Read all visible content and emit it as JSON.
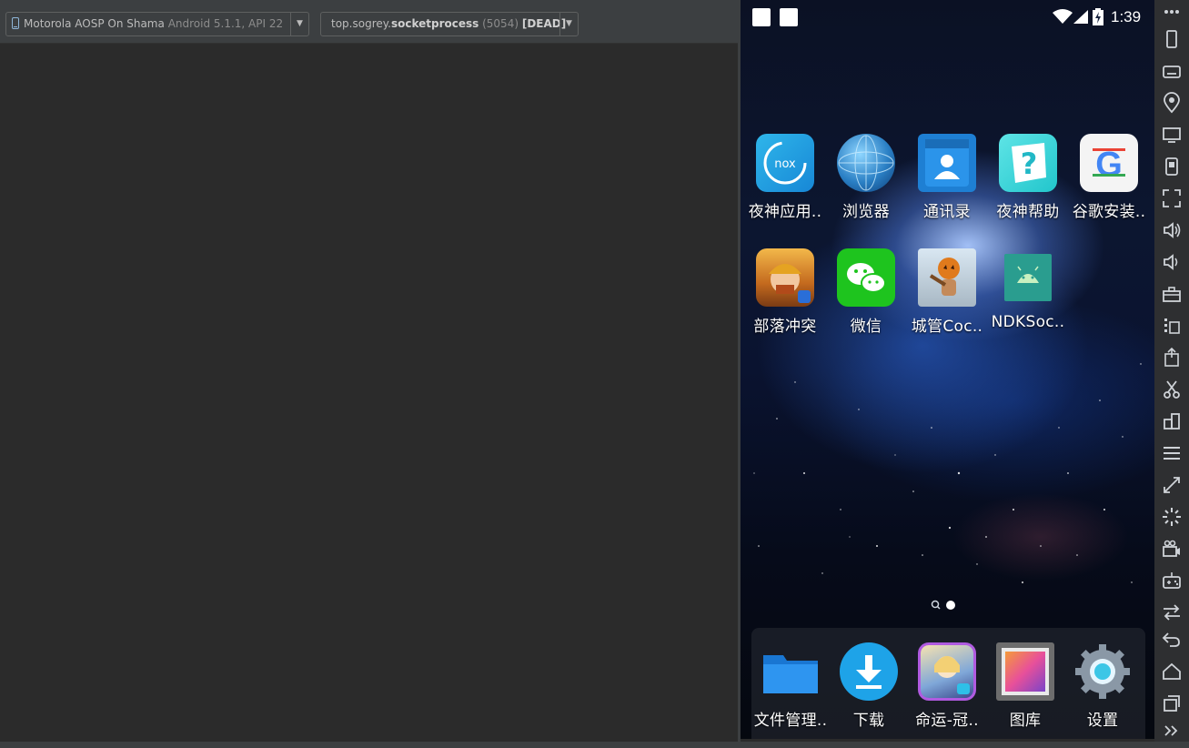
{
  "ide": {
    "device_name": "Motorola AOSP On Shama",
    "device_api": "Android 5.1.1, API 22",
    "process_prefix": "top.sogrey.",
    "process_name": "socketprocess",
    "process_pid": "(5054)",
    "process_state": "[DEAD]"
  },
  "phone": {
    "time": "1:39",
    "apps": [
      {
        "label": "夜神应用..",
        "icon": "nox-app-store-icon"
      },
      {
        "label": "浏览器",
        "icon": "browser-globe-icon"
      },
      {
        "label": "通讯录",
        "icon": "contacts-icon"
      },
      {
        "label": "夜神帮助",
        "icon": "nox-help-icon"
      },
      {
        "label": "谷歌安装..",
        "icon": "google-installer-icon"
      },
      {
        "label": "部落冲突",
        "icon": "clash-of-clans-icon"
      },
      {
        "label": "微信",
        "icon": "wechat-icon"
      },
      {
        "label": "城管Coc..",
        "icon": "coc-pumpkin-icon"
      },
      {
        "label": "NDKSoc..",
        "icon": "android-robot-icon"
      }
    ],
    "dock": [
      {
        "label": "文件管理..",
        "icon": "folder-icon"
      },
      {
        "label": "下载",
        "icon": "download-icon"
      },
      {
        "label": "命运-冠..",
        "icon": "fate-game-icon"
      },
      {
        "label": "图库",
        "icon": "gallery-icon"
      },
      {
        "label": "设置",
        "icon": "settings-gear-icon"
      }
    ]
  },
  "sidebar": [
    "phone-mode-icon",
    "keyboard-icon",
    "location-icon",
    "screen-icon",
    "shake-icon",
    "fullscreen-icon",
    "volume-up-icon",
    "volume-down-icon",
    "toolbox-icon",
    "add-apk-icon",
    "install-apk-icon",
    "scissors-icon",
    "multi-instance-icon",
    "menu-icon",
    "fullscreen-expand-icon",
    "loading-icon",
    "video-record-icon",
    "gamepad-icon",
    "sync-icon",
    "back-icon",
    "home-icon",
    "recent-apps-icon",
    "more-icon"
  ]
}
